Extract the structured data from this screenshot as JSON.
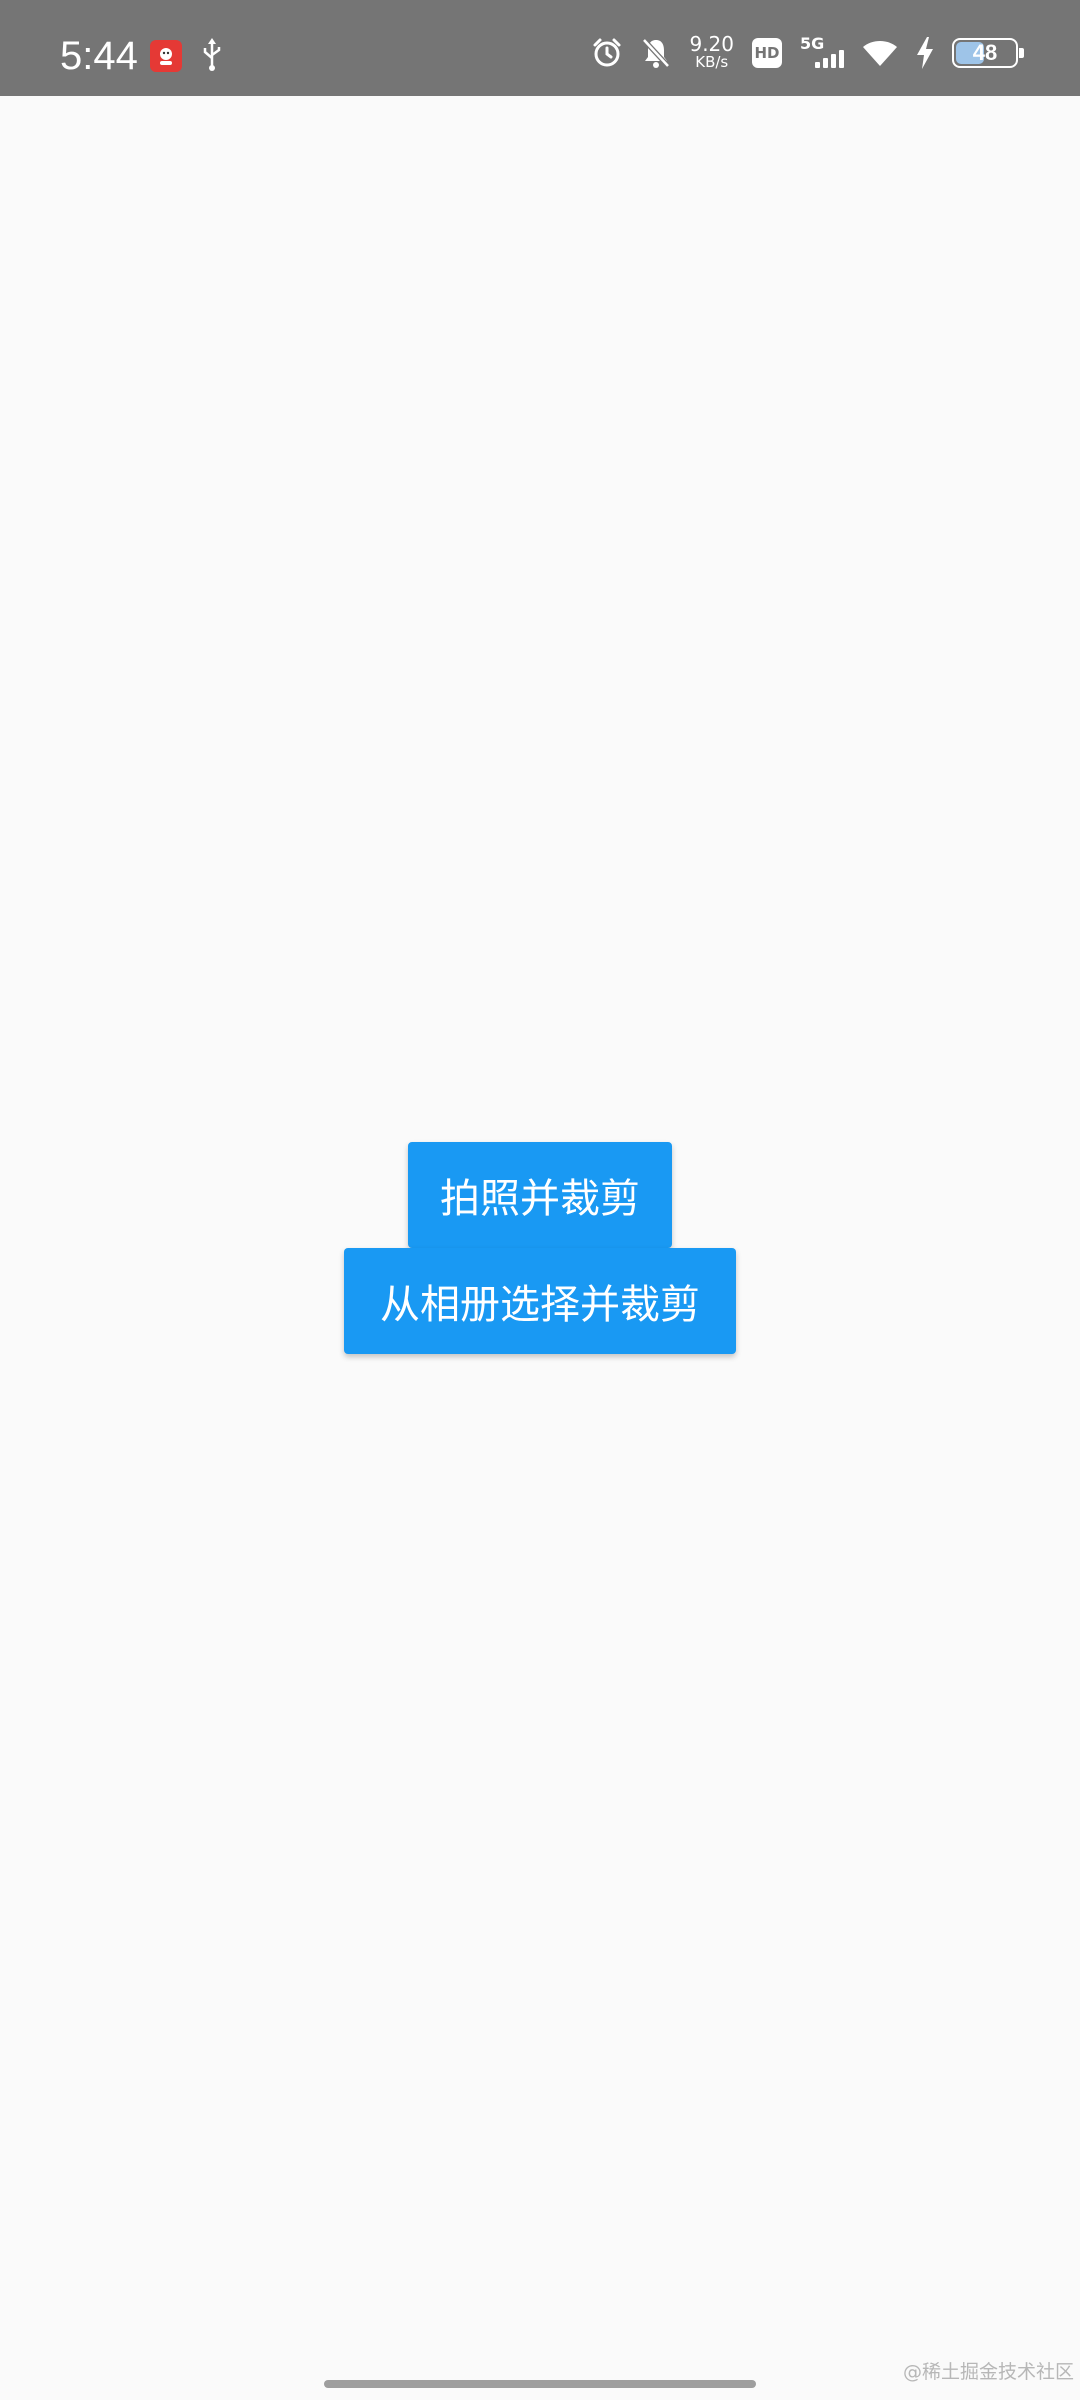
{
  "status_bar": {
    "time": "5:44",
    "net_speed_value": "9.20",
    "net_speed_unit": "KB/s",
    "hd_label": "HD",
    "network_type": "5G",
    "battery_level": "48",
    "battery_fraction": 0.48,
    "icons": [
      "app-notification-icon",
      "usb-icon",
      "alarm-icon",
      "bell-off-icon",
      "hd-icon",
      "signal-icon",
      "wifi-icon",
      "charging-bolt-icon",
      "battery-icon"
    ]
  },
  "main": {
    "take_photo_label": "拍照并裁剪",
    "album_label": "从相册选择并裁剪"
  },
  "watermark": "@稀土掘金技术社区",
  "colors": {
    "status_bar_bg": "#757575",
    "background": "#fafafa",
    "button_bg": "#1999f3",
    "button_text": "#ffffff"
  }
}
